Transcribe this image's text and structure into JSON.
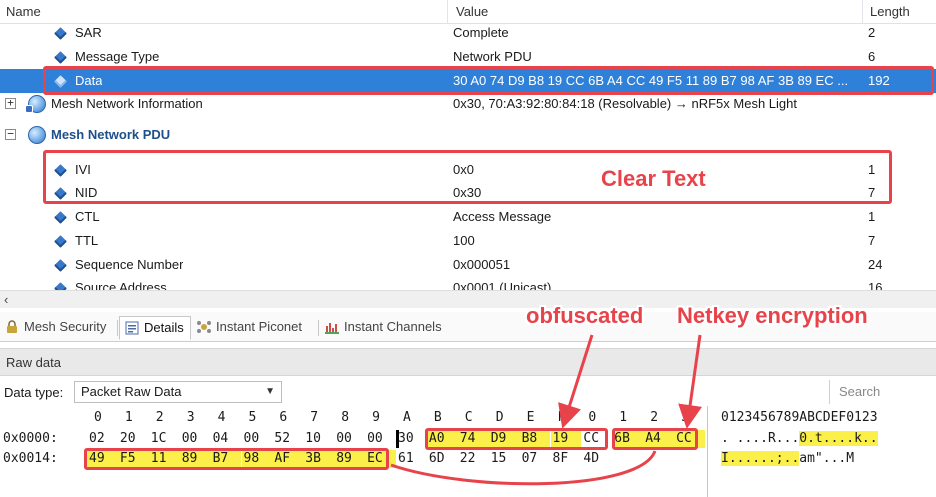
{
  "grid": {
    "columns": {
      "name": "Name",
      "value": "Value",
      "length": "Length"
    },
    "rows": [
      {
        "name": "SAR",
        "value": "Complete",
        "length": "2"
      },
      {
        "name": "Message Type",
        "value": "Network PDU",
        "length": "6"
      },
      {
        "name": "Data",
        "value": "30 A0 74 D9 B8 19 CC 6B A4 CC 49 F5 11 89 B7 98 AF 3B 89 EC ...",
        "length": "192"
      },
      {
        "name": "Mesh Network Information",
        "value": "0x30, 70:A3:92:80:84:18 (Resolvable) → nRF5x Mesh Light",
        "length": ""
      },
      {
        "name": "Mesh Network PDU",
        "value": "",
        "length": ""
      },
      {
        "name": "IVI",
        "value": "0x0",
        "length": "1"
      },
      {
        "name": "NID",
        "value": "0x30",
        "length": "7"
      },
      {
        "name": "CTL",
        "value": "Access Message",
        "length": "1"
      },
      {
        "name": "TTL",
        "value": "100",
        "length": "7"
      },
      {
        "name": "Sequence Number",
        "value": "0x000051",
        "length": "24"
      },
      {
        "name": "Source Address",
        "value": "0x0001 (Unicast)",
        "length": "16"
      }
    ]
  },
  "tabs": [
    {
      "label": "Mesh Security"
    },
    {
      "label": "Details"
    },
    {
      "label": "Instant Piconet"
    },
    {
      "label": "Instant Channels"
    }
  ],
  "raw": {
    "title": "Raw data",
    "data_type_label": "Data type:",
    "data_type_value": "Packet Raw Data",
    "search_placeholder": "Search",
    "hex_header": [
      "0",
      "1",
      "2",
      "3",
      "4",
      "5",
      "6",
      "7",
      "8",
      "9",
      "A",
      "B",
      "C",
      "D",
      "E",
      "F",
      "0",
      "1",
      "2",
      "3"
    ],
    "lines": [
      {
        "addr": "0x0000:",
        "bytes": [
          "02",
          "20",
          "1C",
          "00",
          "04",
          "00",
          "52",
          "10",
          "00",
          "00",
          "30",
          "A0",
          "74",
          "D9",
          "B8",
          "19",
          "CC",
          "6B",
          "A4",
          "CC"
        ]
      },
      {
        "addr": "0x0014:",
        "bytes": [
          "49",
          "F5",
          "11",
          "89",
          "B7",
          "98",
          "AF",
          "3B",
          "89",
          "EC",
          "61",
          "6D",
          "22",
          "15",
          "07",
          "8F",
          "4D"
        ]
      }
    ],
    "ascii_header": "0123456789ABCDEF0123",
    "ascii_lines": [
      {
        "plain": ". ....R...",
        "highlight": "0.t....k..",
        "tail": ""
      },
      {
        "plain": "",
        "highlight": "I......;..",
        "tail": "am\"...M"
      }
    ]
  },
  "annotations": {
    "clear_text": "Clear Text",
    "obfuscated": "obfuscated",
    "netkey": "Netkey encryption",
    "color": "#e8434b",
    "highlight_color": "#fbf04a",
    "selection_color": "#2f80d8"
  }
}
